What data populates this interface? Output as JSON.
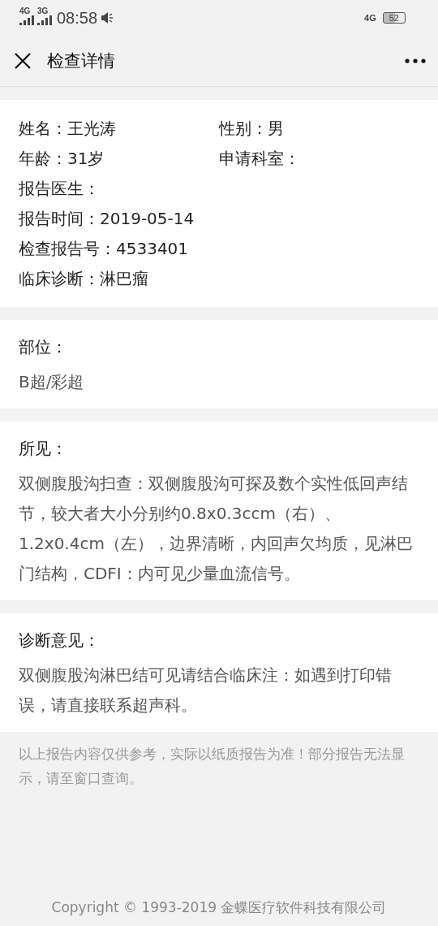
{
  "status_bar": {
    "networks": [
      "4G",
      "3G"
    ],
    "time": "08:58",
    "right_network": "4G",
    "battery": "52"
  },
  "header": {
    "title": "检查详情"
  },
  "patient_info": {
    "rows": [
      [
        {
          "label": "姓名：",
          "value": "王光涛"
        },
        {
          "label": "性别：",
          "value": "男"
        }
      ],
      [
        {
          "label": "年龄：",
          "value": "31岁"
        },
        {
          "label": "申请科室："
        }
      ],
      [
        {
          "label": "报告医生："
        }
      ],
      [
        {
          "label": "报告时间：",
          "value": "2019-05-14"
        }
      ],
      [
        {
          "label": "检查报告号：",
          "value": "4533401"
        }
      ],
      [
        {
          "label": "临床诊断：",
          "value": "淋巴瘤"
        }
      ]
    ]
  },
  "sections": [
    {
      "title": "部位：",
      "body": "B超/彩超"
    },
    {
      "title": "所见：",
      "body": "双侧腹股沟扫查：双侧腹股沟可探及数个实性低回声结节，较大者大小分别约0.8x0.3ccm（右）、1.2x0.4cm（左），边界清晰，内回声欠均质，见淋巴门结构，CDFI：内可见少量血流信号。"
    },
    {
      "title": "诊断意见：",
      "body": "双侧腹股沟淋巴结可见请结合临床注：如遇到打印错误，请直接联系超声科。"
    }
  ],
  "note": "以上报告内容仅供参考，实际以纸质报告为准！部分报告无法显示，请至窗口查询。",
  "copyright": "Copyright © 1993-2019 金蝶医疗软件科技有限公司"
}
